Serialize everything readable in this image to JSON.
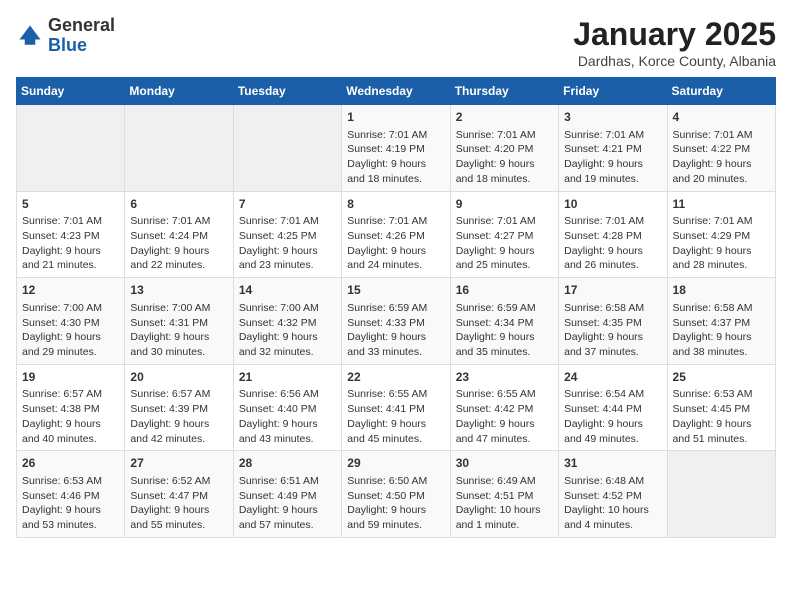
{
  "logo": {
    "general": "General",
    "blue": "Blue"
  },
  "title": {
    "month": "January 2025",
    "location": "Dardhas, Korce County, Albania"
  },
  "weekdays": [
    "Sunday",
    "Monday",
    "Tuesday",
    "Wednesday",
    "Thursday",
    "Friday",
    "Saturday"
  ],
  "weeks": [
    [
      {
        "day": "",
        "info": ""
      },
      {
        "day": "",
        "info": ""
      },
      {
        "day": "",
        "info": ""
      },
      {
        "day": "1",
        "info": "Sunrise: 7:01 AM\nSunset: 4:19 PM\nDaylight: 9 hours and 18 minutes."
      },
      {
        "day": "2",
        "info": "Sunrise: 7:01 AM\nSunset: 4:20 PM\nDaylight: 9 hours and 18 minutes."
      },
      {
        "day": "3",
        "info": "Sunrise: 7:01 AM\nSunset: 4:21 PM\nDaylight: 9 hours and 19 minutes."
      },
      {
        "day": "4",
        "info": "Sunrise: 7:01 AM\nSunset: 4:22 PM\nDaylight: 9 hours and 20 minutes."
      }
    ],
    [
      {
        "day": "5",
        "info": "Sunrise: 7:01 AM\nSunset: 4:23 PM\nDaylight: 9 hours and 21 minutes."
      },
      {
        "day": "6",
        "info": "Sunrise: 7:01 AM\nSunset: 4:24 PM\nDaylight: 9 hours and 22 minutes."
      },
      {
        "day": "7",
        "info": "Sunrise: 7:01 AM\nSunset: 4:25 PM\nDaylight: 9 hours and 23 minutes."
      },
      {
        "day": "8",
        "info": "Sunrise: 7:01 AM\nSunset: 4:26 PM\nDaylight: 9 hours and 24 minutes."
      },
      {
        "day": "9",
        "info": "Sunrise: 7:01 AM\nSunset: 4:27 PM\nDaylight: 9 hours and 25 minutes."
      },
      {
        "day": "10",
        "info": "Sunrise: 7:01 AM\nSunset: 4:28 PM\nDaylight: 9 hours and 26 minutes."
      },
      {
        "day": "11",
        "info": "Sunrise: 7:01 AM\nSunset: 4:29 PM\nDaylight: 9 hours and 28 minutes."
      }
    ],
    [
      {
        "day": "12",
        "info": "Sunrise: 7:00 AM\nSunset: 4:30 PM\nDaylight: 9 hours and 29 minutes."
      },
      {
        "day": "13",
        "info": "Sunrise: 7:00 AM\nSunset: 4:31 PM\nDaylight: 9 hours and 30 minutes."
      },
      {
        "day": "14",
        "info": "Sunrise: 7:00 AM\nSunset: 4:32 PM\nDaylight: 9 hours and 32 minutes."
      },
      {
        "day": "15",
        "info": "Sunrise: 6:59 AM\nSunset: 4:33 PM\nDaylight: 9 hours and 33 minutes."
      },
      {
        "day": "16",
        "info": "Sunrise: 6:59 AM\nSunset: 4:34 PM\nDaylight: 9 hours and 35 minutes."
      },
      {
        "day": "17",
        "info": "Sunrise: 6:58 AM\nSunset: 4:35 PM\nDaylight: 9 hours and 37 minutes."
      },
      {
        "day": "18",
        "info": "Sunrise: 6:58 AM\nSunset: 4:37 PM\nDaylight: 9 hours and 38 minutes."
      }
    ],
    [
      {
        "day": "19",
        "info": "Sunrise: 6:57 AM\nSunset: 4:38 PM\nDaylight: 9 hours and 40 minutes."
      },
      {
        "day": "20",
        "info": "Sunrise: 6:57 AM\nSunset: 4:39 PM\nDaylight: 9 hours and 42 minutes."
      },
      {
        "day": "21",
        "info": "Sunrise: 6:56 AM\nSunset: 4:40 PM\nDaylight: 9 hours and 43 minutes."
      },
      {
        "day": "22",
        "info": "Sunrise: 6:55 AM\nSunset: 4:41 PM\nDaylight: 9 hours and 45 minutes."
      },
      {
        "day": "23",
        "info": "Sunrise: 6:55 AM\nSunset: 4:42 PM\nDaylight: 9 hours and 47 minutes."
      },
      {
        "day": "24",
        "info": "Sunrise: 6:54 AM\nSunset: 4:44 PM\nDaylight: 9 hours and 49 minutes."
      },
      {
        "day": "25",
        "info": "Sunrise: 6:53 AM\nSunset: 4:45 PM\nDaylight: 9 hours and 51 minutes."
      }
    ],
    [
      {
        "day": "26",
        "info": "Sunrise: 6:53 AM\nSunset: 4:46 PM\nDaylight: 9 hours and 53 minutes."
      },
      {
        "day": "27",
        "info": "Sunrise: 6:52 AM\nSunset: 4:47 PM\nDaylight: 9 hours and 55 minutes."
      },
      {
        "day": "28",
        "info": "Sunrise: 6:51 AM\nSunset: 4:49 PM\nDaylight: 9 hours and 57 minutes."
      },
      {
        "day": "29",
        "info": "Sunrise: 6:50 AM\nSunset: 4:50 PM\nDaylight: 9 hours and 59 minutes."
      },
      {
        "day": "30",
        "info": "Sunrise: 6:49 AM\nSunset: 4:51 PM\nDaylight: 10 hours and 1 minute."
      },
      {
        "day": "31",
        "info": "Sunrise: 6:48 AM\nSunset: 4:52 PM\nDaylight: 10 hours and 4 minutes."
      },
      {
        "day": "",
        "info": ""
      }
    ]
  ]
}
